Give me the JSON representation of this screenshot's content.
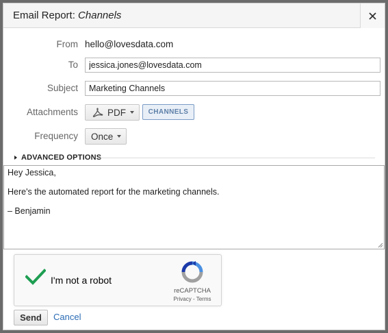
{
  "dialog": {
    "title_prefix": "Email Report:",
    "title_report": "Channels",
    "close_icon": "close-icon"
  },
  "form": {
    "from_label": "From",
    "from_value": "hello@lovesdata.com",
    "to_label": "To",
    "to_value": "jessica.jones@lovesdata.com",
    "subject_label": "Subject",
    "subject_value": "Marketing Channels",
    "attachments_label": "Attachments",
    "format_value": "PDF",
    "format_icon": "pdf-icon",
    "attachment_chip": "CHANNELS",
    "frequency_label": "Frequency",
    "frequency_value": "Once",
    "advanced_label": "ADVANCED OPTIONS"
  },
  "message": {
    "lines": [
      "Hey Jessica,",
      "Here's the automated report for the marketing channels.",
      "– Benjamin"
    ]
  },
  "recaptcha": {
    "label": "I'm not a robot",
    "brand": "reCAPTCHA",
    "links": "Privacy - Terms",
    "checked": true
  },
  "actions": {
    "send_label": "Send",
    "cancel_label": "Cancel"
  },
  "colors": {
    "link": "#2a6bb5",
    "check": "#1e9e52",
    "chip_border": "#7a9cc6"
  }
}
